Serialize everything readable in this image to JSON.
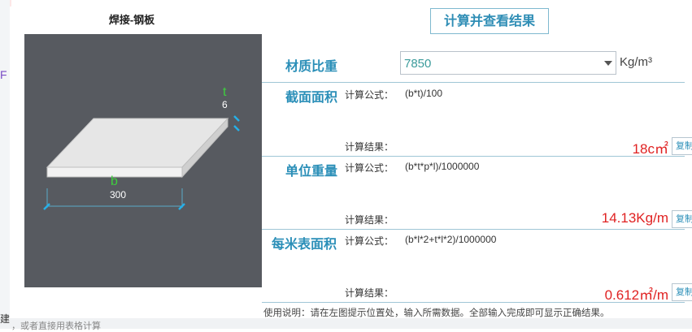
{
  "window": {
    "title": "焊接-钢板"
  },
  "toolbar": {
    "calc_button": "计算并查看结果"
  },
  "material": {
    "label": "材质比重",
    "value": "7850",
    "unit": "Kg/m³"
  },
  "diagram": {
    "t_label": "t",
    "t_value": "6",
    "b_label": "b",
    "b_value": "300"
  },
  "sections": [
    {
      "label": "截面面积",
      "formula_label": "计算公式：",
      "formula": "(b*t)/100",
      "result_label": "计算结果：",
      "result": "18c㎡",
      "copy": "复制"
    },
    {
      "label": "单位重量",
      "formula_label": "计算公式：",
      "formula": "(b*t*p*l)/1000000",
      "result_label": "计算结果：",
      "result": "14.13Kg/m",
      "copy": "复制"
    },
    {
      "label": "每米表面积",
      "formula_label": "计算公式：",
      "formula": "(b*l*2+t*l*2)/1000000",
      "result_label": "计算结果：",
      "result": "0.612㎡/m",
      "copy": "复制"
    }
  ],
  "usage": "使用说明：请在左图提示位置处，输入所需数据。全部输入完成即可显示正确结果。",
  "background": {
    "left_mark": "F",
    "bottom_text": "建",
    "bottom_faint": "，或者直接用表格计算"
  },
  "colors": {
    "accent": "#2b8fb8",
    "result": "#e02222",
    "diagram_bg": "#575a60",
    "green_label": "#3ecf3e"
  }
}
